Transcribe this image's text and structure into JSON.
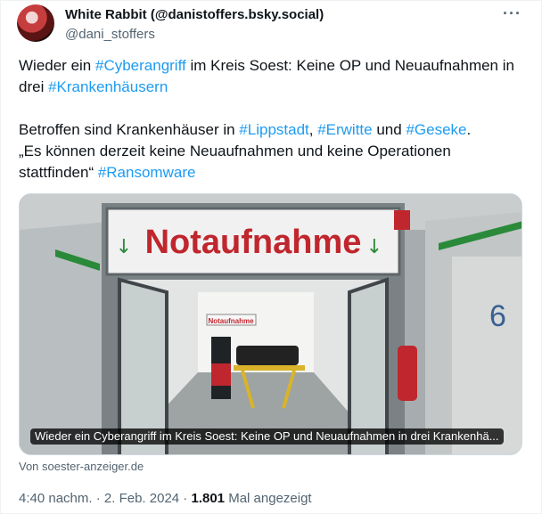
{
  "author": {
    "display_name": "White Rabbit (@danistoffers.bsky.social)",
    "handle": "@dani_stoffers"
  },
  "more_icon": "more-horizontal-icon",
  "tweet": {
    "line1_prefix": "Wieder ein ",
    "tag_cyberangriff": "#Cyberangriff",
    "line1_suffix": " im Kreis Soest: Keine OP und Neuaufnahmen in drei ",
    "tag_krankenhaeusern": "#Krankenhäusern",
    "line2_prefix": "Betroffen sind Krankenhäuser in ",
    "tag_lippstadt": "#Lippstadt",
    "sep_comma": ", ",
    "tag_erwitte": "#Erwitte",
    "sep_und": " und ",
    "tag_geseke": "#Geseke",
    "line2_period": ".",
    "quote": "„Es können derzeit keine Neuaufnahmen und keine Operationen stattfinden“ ",
    "tag_ransomware": "#Ransomware"
  },
  "card": {
    "sign_text": "Notaufnahme",
    "small_sign_text": "Notaufnahme",
    "door_number": "6",
    "caption": "Wieder ein Cyberangriff im Kreis Soest: Keine OP und Neuaufnahmen in drei Krankenhä...",
    "source": "Von soester-anzeiger.de"
  },
  "meta": {
    "time": "4:40 nachm.",
    "dot1": " · ",
    "date": "2. Feb. 2024",
    "dot2": " · ",
    "views": "1.801",
    "views_label": " Mal angezeigt"
  },
  "colors": {
    "link": "#1d9bf0",
    "secondary_text": "#536471",
    "sign_red": "#c0262d",
    "sign_green": "#2a8a3a"
  }
}
